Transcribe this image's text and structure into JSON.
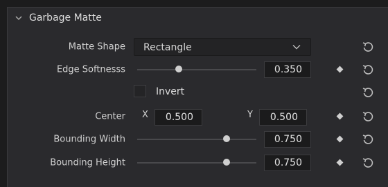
{
  "section": {
    "title": "Garbage Matte"
  },
  "matte_shape": {
    "label": "Matte Shape",
    "value": "Rectangle"
  },
  "edge_softness": {
    "label": "Edge Softnesss",
    "value": "0.350",
    "level": 0.35
  },
  "invert": {
    "label": "Invert",
    "checked": false
  },
  "center": {
    "label": "Center",
    "x_label": "X",
    "x_value": "0.500",
    "y_label": "Y",
    "y_value": "0.500"
  },
  "bounding_width": {
    "label": "Bounding Width",
    "value": "0.750",
    "level": 0.75
  },
  "bounding_height": {
    "label": "Bounding Height",
    "value": "0.750",
    "level": 0.75
  },
  "icons": {
    "collapse": "chevron-down-icon",
    "reset": "reset-icon",
    "keyframe": "keyframe-diamond-icon"
  }
}
